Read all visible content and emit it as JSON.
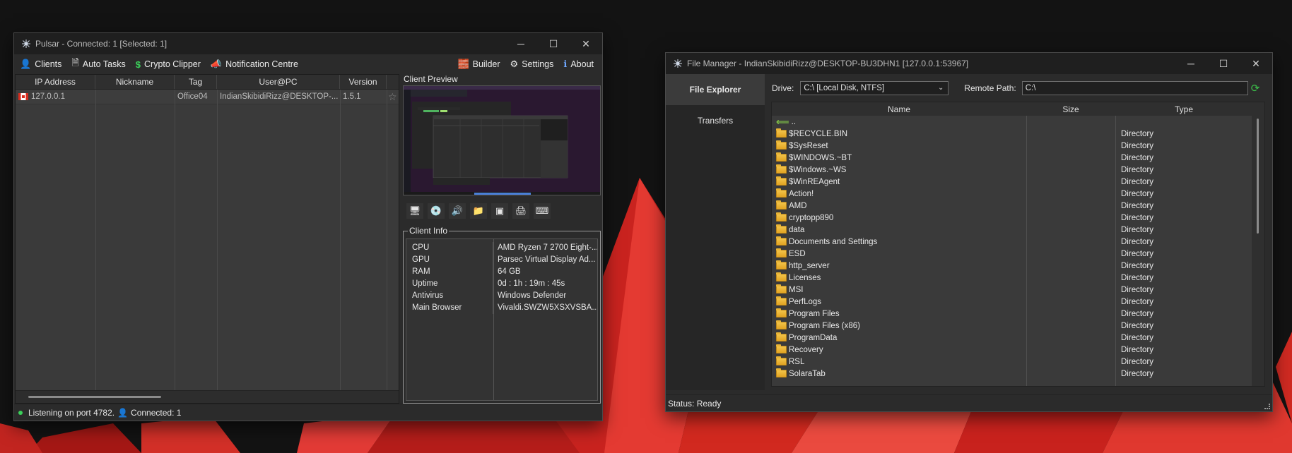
{
  "pulsar": {
    "title": "Pulsar - Connected: 1 [Selected: 1]",
    "menu_left": [
      {
        "icon": "👤",
        "label": "Clients"
      },
      {
        "icon": "🗎",
        "label": "Auto Tasks"
      },
      {
        "icon": "$",
        "label": "Crypto Clipper"
      },
      {
        "icon": "📣",
        "label": "Notification Centre"
      }
    ],
    "menu_right": [
      {
        "icon": "🧱",
        "label": "Builder"
      },
      {
        "icon": "⚙",
        "label": "Settings"
      },
      {
        "icon": "ℹ",
        "label": "About"
      }
    ],
    "grid": {
      "headers": [
        "IP Address",
        "Nickname",
        "Tag",
        "User@PC",
        "Version"
      ],
      "rows": [
        {
          "ip": "127.0.0.1",
          "nickname": "",
          "tag": "Office04",
          "user": "IndianSkibidiRizz@DESKTOP-...",
          "version": "1.5.1",
          "star": "☆"
        }
      ]
    },
    "preview": {
      "label": "Client Preview"
    },
    "tools": [
      {
        "icon": "🖥"
      },
      {
        "icon": "💿"
      },
      {
        "icon": "🔊"
      },
      {
        "icon": "📁"
      },
      {
        "icon": "▣"
      },
      {
        "icon": "🖨"
      },
      {
        "icon": "⌨"
      }
    ],
    "client_info": {
      "legend": "Client Info",
      "rows": [
        {
          "key": "CPU",
          "value": "AMD Ryzen 7 2700 Eight-..."
        },
        {
          "key": "GPU",
          "value": "Parsec Virtual Display Ad..."
        },
        {
          "key": "RAM",
          "value": "64 GB"
        },
        {
          "key": "Uptime",
          "value": "0d : 1h : 19m : 45s"
        },
        {
          "key": "Antivirus",
          "value": "Windows Defender"
        },
        {
          "key": "Main Browser",
          "value": "Vivaldi.SWZW5XSXVSBA..."
        }
      ]
    },
    "status": {
      "listening": "Listening on port 4782.",
      "connected": "Connected: 1"
    }
  },
  "file_manager": {
    "title": "File Manager - IndianSkibidiRizz@DESKTOP-BU3DHN1 [127.0.0.1:53967]",
    "tabs": [
      "File Explorer",
      "Transfers"
    ],
    "drive_label": "Drive:",
    "drive_value": "C:\\ [Local Disk, NTFS]",
    "remote_path_label": "Remote Path:",
    "remote_path_value": "C:\\",
    "headers": [
      "Name",
      "Size",
      "Type"
    ],
    "up_entry": "..",
    "entries": [
      {
        "name": "$RECYCLE.BIN",
        "type": "Directory"
      },
      {
        "name": "$SysReset",
        "type": "Directory"
      },
      {
        "name": "$WINDOWS.~BT",
        "type": "Directory"
      },
      {
        "name": "$Windows.~WS",
        "type": "Directory"
      },
      {
        "name": "$WinREAgent",
        "type": "Directory"
      },
      {
        "name": "Action!",
        "type": "Directory"
      },
      {
        "name": "AMD",
        "type": "Directory"
      },
      {
        "name": "cryptopp890",
        "type": "Directory"
      },
      {
        "name": "data",
        "type": "Directory"
      },
      {
        "name": "Documents and Settings",
        "type": "Directory"
      },
      {
        "name": "ESD",
        "type": "Directory"
      },
      {
        "name": "http_server",
        "type": "Directory"
      },
      {
        "name": "Licenses",
        "type": "Directory"
      },
      {
        "name": "MSI",
        "type": "Directory"
      },
      {
        "name": "PerfLogs",
        "type": "Directory"
      },
      {
        "name": "Program Files",
        "type": "Directory"
      },
      {
        "name": "Program Files (x86)",
        "type": "Directory"
      },
      {
        "name": "ProgramData",
        "type": "Directory"
      },
      {
        "name": "Recovery",
        "type": "Directory"
      },
      {
        "name": "RSL",
        "type": "Directory"
      },
      {
        "name": "SolaraTab",
        "type": "Directory"
      }
    ],
    "status": "Status: Ready"
  },
  "colors": {
    "accent_green": "#3bd15a",
    "desktop_red": "#e0322e",
    "window_bg": "#2b2b2b"
  }
}
